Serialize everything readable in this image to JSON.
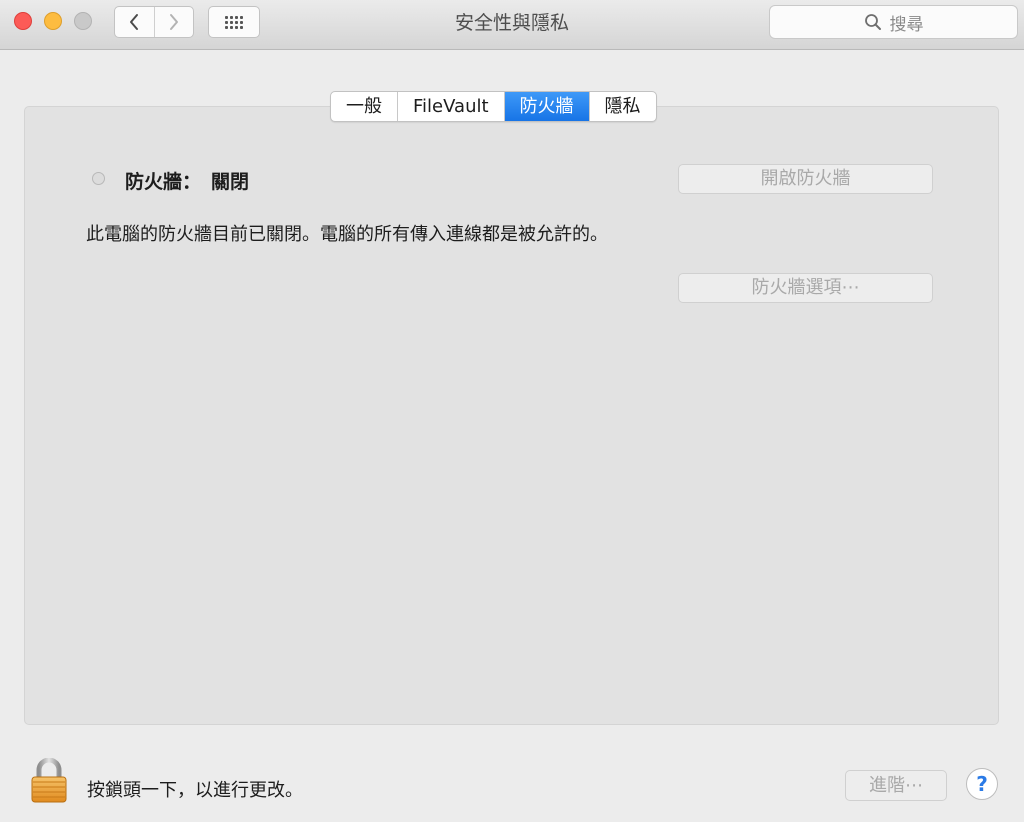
{
  "window": {
    "title": "安全性與隱私",
    "search_placeholder": "搜尋"
  },
  "tabs": [
    {
      "label": "一般",
      "selected": false
    },
    {
      "label": "FileVault",
      "selected": false
    },
    {
      "label": "防火牆",
      "selected": true
    },
    {
      "label": "隱私",
      "selected": false
    }
  ],
  "firewall": {
    "status_label": "防火牆：",
    "status_value": "關閉",
    "description": "此電腦的防火牆目前已關閉。電腦的所有傳入連線都是被允許的。",
    "turn_on_button": "開啟防火牆",
    "options_button": "防火牆選項⋯"
  },
  "footer": {
    "lock_text": "按鎖頭一下，以進行更改。",
    "advanced_button": "進階⋯",
    "help_label": "?"
  },
  "colors": {
    "accent": "#1a77e8",
    "close": "#fc5b57",
    "minimize": "#fdbc40",
    "lock": "#e89a2c"
  },
  "icons": [
    "chevron-left-icon",
    "chevron-right-icon",
    "grid-icon",
    "search-icon",
    "lock-icon",
    "help-icon"
  ]
}
